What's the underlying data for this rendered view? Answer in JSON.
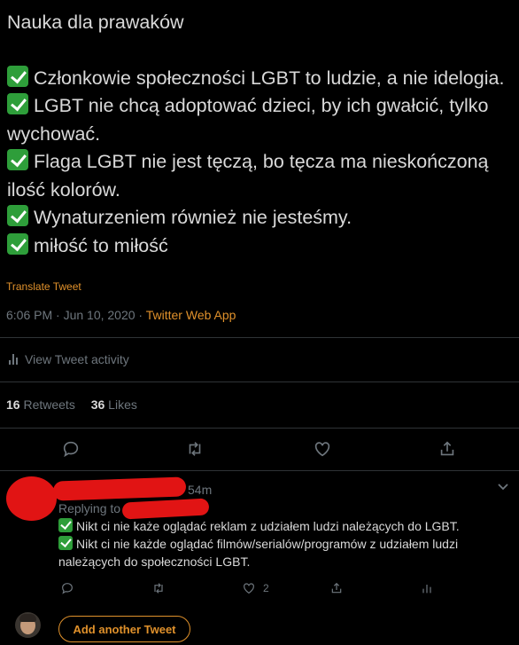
{
  "tweet": {
    "title_line": "Nauka dla prawaków",
    "lines": [
      "Członkowie społeczności LGBT to ludzie, a nie idelogia.",
      "LGBT nie chcą adoptować dzieci, by ich gwałcić, tylko wychować.",
      "Flaga LGBT nie jest tęczą, bo tęcza ma nieskończoną ilość kolorów.",
      "Wynaturzeniem również nie jesteśmy.",
      "miłość to miłość"
    ],
    "translate_label": "Translate Tweet",
    "timestamp": "6:06 PM · Jun 10, 2020 · ",
    "client": "Twitter Web App",
    "activity_label": "View Tweet activity",
    "retweets_count": "16",
    "retweets_label": " Retweets",
    "likes_count": "36",
    "likes_label": " Likes"
  },
  "reply": {
    "time": "54m",
    "replying_to": "Replying to",
    "lines": [
      "Nikt ci nie każe oglądać reklam z udziałem ludzi należących do LGBT.",
      "Nikt ci nie każde oglądać filmów/serialów/programów z udziałem ludzi należących do społeczności LGBT."
    ],
    "like_count": "2"
  },
  "composer": {
    "add_label": "Add another Tweet"
  },
  "colors": {
    "background": "#000000",
    "accent": "#e0912b",
    "muted": "#6e767d",
    "redaction": "#e11414",
    "check": "#2e9e3a"
  },
  "icons": [
    "checkmark-icon",
    "bar-chart-icon",
    "reply-icon",
    "retweet-icon",
    "like-icon",
    "share-icon",
    "chevron-down-icon"
  ]
}
